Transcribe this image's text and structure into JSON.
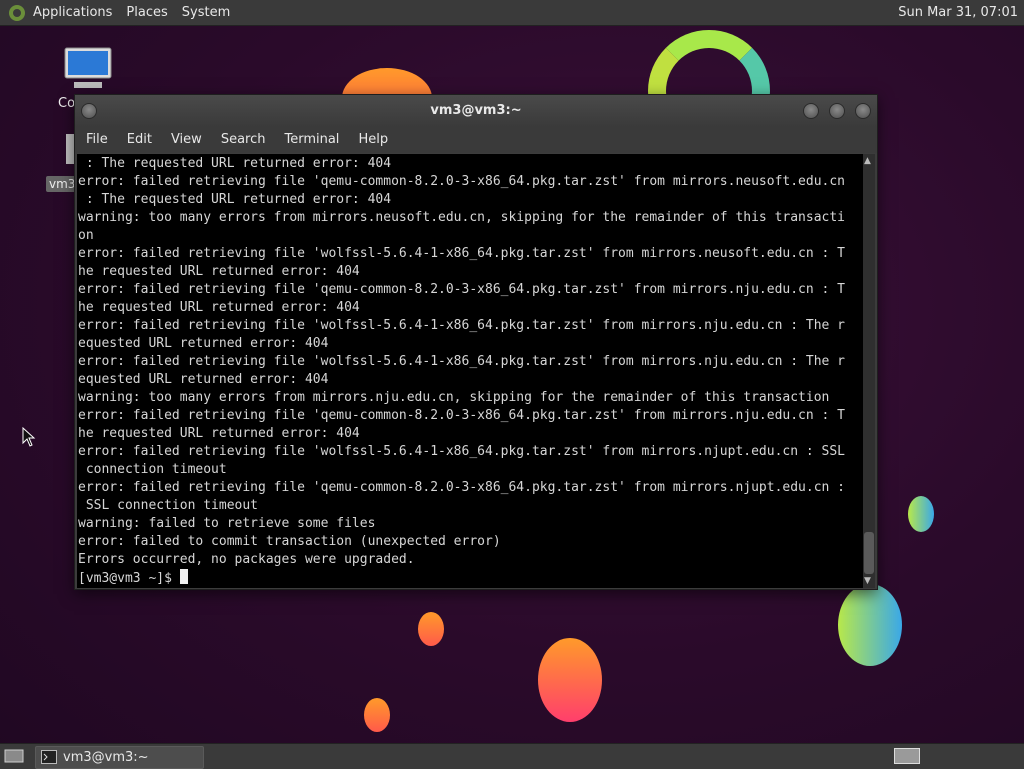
{
  "top_panel": {
    "menus": [
      "Applications",
      "Places",
      "System"
    ],
    "clock": "Sun Mar 31, 07:01"
  },
  "desktop": {
    "icons": [
      {
        "label": "Co",
        "icon": "computer-icon"
      },
      {
        "label": "vm3",
        "icon": "home-folder-icon"
      }
    ]
  },
  "window": {
    "title": "vm3@vm3:~",
    "menu": [
      "File",
      "Edit",
      "View",
      "Search",
      "Terminal",
      "Help"
    ],
    "lines": [
      " : The requested URL returned error: 404",
      "error: failed retrieving file 'qemu-common-8.2.0-3-x86_64.pkg.tar.zst' from mirrors.neusoft.edu.cn",
      " : The requested URL returned error: 404",
      "warning: too many errors from mirrors.neusoft.edu.cn, skipping for the remainder of this transacti",
      "on",
      "error: failed retrieving file 'wolfssl-5.6.4-1-x86_64.pkg.tar.zst' from mirrors.neusoft.edu.cn : T",
      "he requested URL returned error: 404",
      "error: failed retrieving file 'qemu-common-8.2.0-3-x86_64.pkg.tar.zst' from mirrors.nju.edu.cn : T",
      "he requested URL returned error: 404",
      "error: failed retrieving file 'wolfssl-5.6.4-1-x86_64.pkg.tar.zst' from mirrors.nju.edu.cn : The r",
      "equested URL returned error: 404",
      "error: failed retrieving file 'wolfssl-5.6.4-1-x86_64.pkg.tar.zst' from mirrors.nju.edu.cn : The r",
      "equested URL returned error: 404",
      "warning: too many errors from mirrors.nju.edu.cn, skipping for the remainder of this transaction",
      "error: failed retrieving file 'qemu-common-8.2.0-3-x86_64.pkg.tar.zst' from mirrors.nju.edu.cn : T",
      "he requested URL returned error: 404",
      "error: failed retrieving file 'wolfssl-5.6.4-1-x86_64.pkg.tar.zst' from mirrors.njupt.edu.cn : SSL",
      " connection timeout",
      "error: failed retrieving file 'qemu-common-8.2.0-3-x86_64.pkg.tar.zst' from mirrors.njupt.edu.cn :",
      " SSL connection timeout",
      "warning: failed to retrieve some files",
      "error: failed to commit transaction (unexpected error)",
      "Errors occurred, no packages were upgraded."
    ],
    "prompt": "[vm3@vm3 ~]$ "
  },
  "bottom_panel": {
    "task_label": "vm3@vm3:~"
  },
  "colors": {
    "desktop_bg": "#2a0a2a",
    "panel": "#3a3a3a",
    "terminal_bg": "#000000",
    "terminal_fg": "#d6d6d6"
  }
}
